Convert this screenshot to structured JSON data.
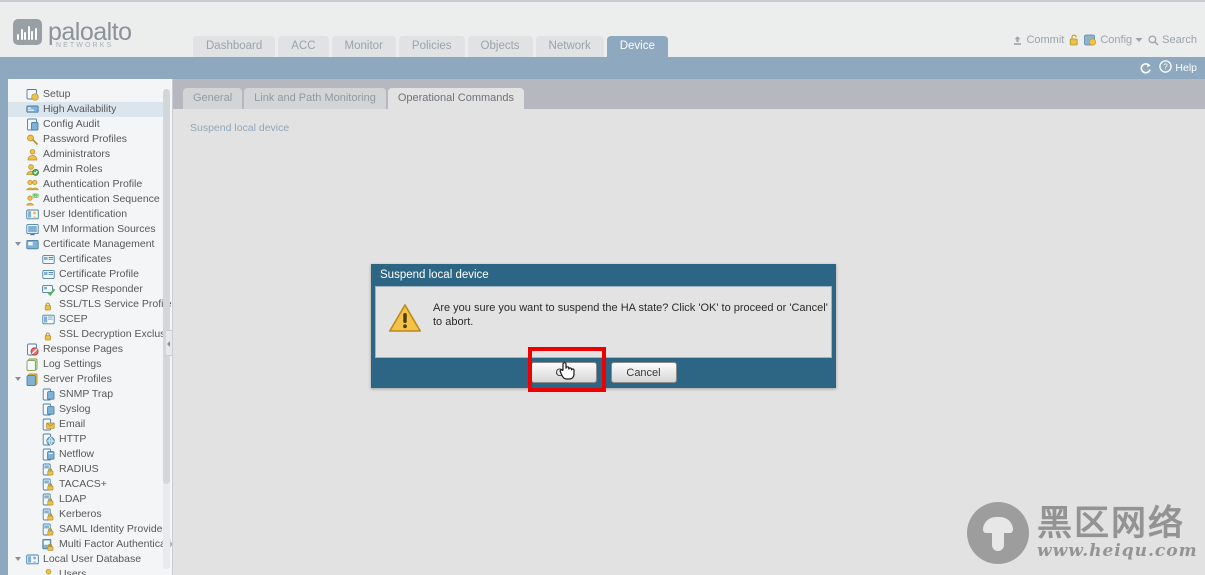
{
  "app": {
    "brand_name": "paloalto",
    "brand_sub": "NETWORKS",
    "accent_blue": "#8ea8bf",
    "dialog_header_color": "#2c6684",
    "highlight_red": "#ee0000",
    "warning_amber": "#f5c146"
  },
  "nav": {
    "tabs": [
      {
        "label": "Dashboard",
        "active": false
      },
      {
        "label": "ACC",
        "active": false
      },
      {
        "label": "Monitor",
        "active": false
      },
      {
        "label": "Policies",
        "active": false
      },
      {
        "label": "Objects",
        "active": false
      },
      {
        "label": "Network",
        "active": false
      },
      {
        "label": "Device",
        "active": true
      }
    ]
  },
  "topright": {
    "commit_label": "Commit",
    "config_label": "Config",
    "search_label": "Search",
    "lock_icon": "lock-icon",
    "commit_icon": "commit-icon",
    "config_icon": "config-icon",
    "search_icon": "search-icon",
    "dropdown_icon": "chevron-down-icon"
  },
  "bluebar": {
    "refresh_icon": "refresh-icon",
    "help_icon": "help-icon",
    "help_label": "Help"
  },
  "sidebar": {
    "items": [
      {
        "label": "Setup",
        "icon": "setup-icon",
        "level": 0,
        "selected": false,
        "expander": "none"
      },
      {
        "label": "High Availability",
        "icon": "ha-icon",
        "level": 0,
        "selected": true,
        "expander": "none"
      },
      {
        "label": "Config Audit",
        "icon": "config-audit-icon",
        "level": 0,
        "selected": false,
        "expander": "none"
      },
      {
        "label": "Password Profiles",
        "icon": "password-icon",
        "level": 0,
        "selected": false,
        "expander": "none"
      },
      {
        "label": "Administrators",
        "icon": "user-icon",
        "level": 0,
        "selected": false,
        "expander": "none"
      },
      {
        "label": "Admin Roles",
        "icon": "admin-roles-icon",
        "level": 0,
        "selected": false,
        "expander": "none"
      },
      {
        "label": "Authentication Profile",
        "icon": "auth-profile-icon",
        "level": 0,
        "selected": false,
        "expander": "none"
      },
      {
        "label": "Authentication Sequence",
        "icon": "auth-seq-icon",
        "level": 0,
        "selected": false,
        "expander": "none"
      },
      {
        "label": "User Identification",
        "icon": "user-id-icon",
        "level": 0,
        "selected": false,
        "expander": "none"
      },
      {
        "label": "VM Information Sources",
        "icon": "vm-info-icon",
        "level": 0,
        "selected": false,
        "expander": "none"
      },
      {
        "label": "Certificate Management",
        "icon": "cert-mgmt-icon",
        "level": 0,
        "selected": false,
        "expander": "open"
      },
      {
        "label": "Certificates",
        "icon": "certificate-icon",
        "level": 1,
        "selected": false,
        "expander": "none"
      },
      {
        "label": "Certificate Profile",
        "icon": "certificate-icon",
        "level": 1,
        "selected": false,
        "expander": "none"
      },
      {
        "label": "OCSP Responder",
        "icon": "ocsp-icon",
        "level": 1,
        "selected": false,
        "expander": "none"
      },
      {
        "label": "SSL/TLS Service Profile",
        "icon": "padlock-icon",
        "level": 1,
        "selected": false,
        "expander": "none"
      },
      {
        "label": "SCEP",
        "icon": "scep-icon",
        "level": 1,
        "selected": false,
        "expander": "none"
      },
      {
        "label": "SSL Decryption Exclusion",
        "icon": "padlock-icon",
        "level": 1,
        "selected": false,
        "expander": "none"
      },
      {
        "label": "Response Pages",
        "icon": "response-pages-icon",
        "level": 0,
        "selected": false,
        "expander": "none"
      },
      {
        "label": "Log Settings",
        "icon": "log-settings-icon",
        "level": 0,
        "selected": false,
        "expander": "none"
      },
      {
        "label": "Server Profiles",
        "icon": "server-profiles-icon",
        "level": 0,
        "selected": false,
        "expander": "open"
      },
      {
        "label": "SNMP Trap",
        "icon": "snmp-icon",
        "level": 1,
        "selected": false,
        "expander": "none"
      },
      {
        "label": "Syslog",
        "icon": "syslog-icon",
        "level": 1,
        "selected": false,
        "expander": "none"
      },
      {
        "label": "Email",
        "icon": "email-icon",
        "level": 1,
        "selected": false,
        "expander": "none"
      },
      {
        "label": "HTTP",
        "icon": "http-icon",
        "level": 1,
        "selected": false,
        "expander": "none"
      },
      {
        "label": "Netflow",
        "icon": "netflow-icon",
        "level": 1,
        "selected": false,
        "expander": "none"
      },
      {
        "label": "RADIUS",
        "icon": "radius-icon",
        "level": 1,
        "selected": false,
        "expander": "none"
      },
      {
        "label": "TACACS+",
        "icon": "tacacs-icon",
        "level": 1,
        "selected": false,
        "expander": "none"
      },
      {
        "label": "LDAP",
        "icon": "ldap-icon",
        "level": 1,
        "selected": false,
        "expander": "none"
      },
      {
        "label": "Kerberos",
        "icon": "kerberos-icon",
        "level": 1,
        "selected": false,
        "expander": "none"
      },
      {
        "label": "SAML Identity Provider",
        "icon": "saml-icon",
        "level": 1,
        "selected": false,
        "expander": "none"
      },
      {
        "label": "Multi Factor Authentication",
        "icon": "mfa-icon",
        "level": 1,
        "selected": false,
        "expander": "none"
      },
      {
        "label": "Local User Database",
        "icon": "local-user-db-icon",
        "level": 0,
        "selected": false,
        "expander": "open"
      },
      {
        "label": "Users",
        "icon": "user-icon",
        "level": 1,
        "selected": false,
        "expander": "none"
      }
    ]
  },
  "main": {
    "subtabs": [
      {
        "label": "General",
        "active": false
      },
      {
        "label": "Link and Path Monitoring",
        "active": false
      },
      {
        "label": "Operational Commands",
        "active": true
      }
    ],
    "operation_link": "Suspend local device"
  },
  "dialog": {
    "title": "Suspend local device",
    "message": "Are you sure you want to suspend the HA state? Click 'OK' to proceed or 'Cancel' to abort.",
    "warning_icon": "warning-triangle-icon",
    "ok_label": "OK",
    "cancel_label": "Cancel"
  },
  "watermark": {
    "logo_icon": "mushroom-logo-icon",
    "cn_text": "黑区网络",
    "url_text": "www.heiqu.com"
  }
}
